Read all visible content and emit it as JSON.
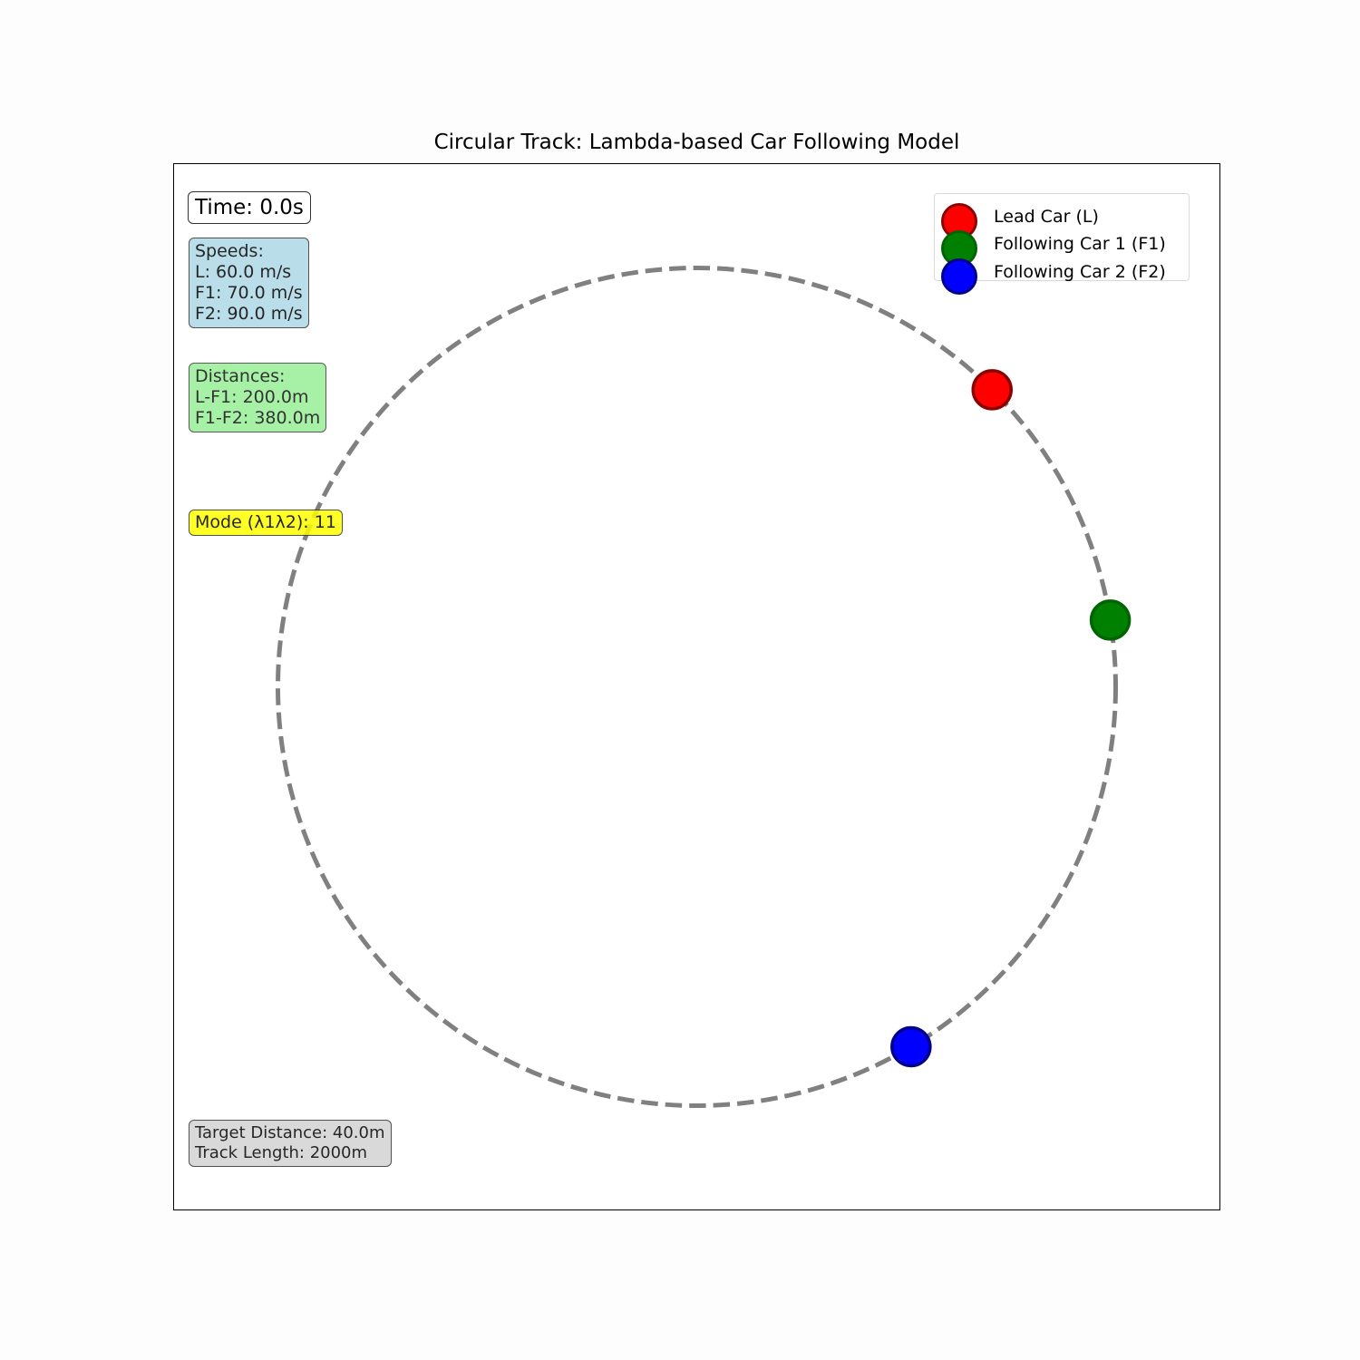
{
  "chart_data": {
    "type": "scatter",
    "title": "Circular Track: Lambda-based Car Following Model",
    "cars": [
      {
        "name": "Lead Car (L)",
        "color": "#ff0000",
        "edge": "#8b0000",
        "track_position_m": 200
      },
      {
        "name": "Following Car 1 (F1)",
        "color": "#008000",
        "edge": "#006400",
        "track_position_m": 0
      },
      {
        "name": "Following Car 2 (F2)",
        "color": "#0000ff",
        "edge": "#00008b",
        "track_position_m": 1620
      }
    ],
    "track": {
      "length_m": 2000,
      "style": "dashed",
      "color": "#808080"
    },
    "legend_position": "top-right",
    "panels": {
      "time": "Time: 0.0s",
      "speeds": "Speeds:\nL: 60.0 m/s\nF1: 70.0 m/s\nF2: 90.0 m/s",
      "distances": "Distances:\nL-F1: 200.0m\nF1-F2: 380.0m",
      "mode": "Mode (λ1λ2): 11",
      "params": "Target Distance: 40.0m\nTrack Length: 2000m"
    }
  }
}
